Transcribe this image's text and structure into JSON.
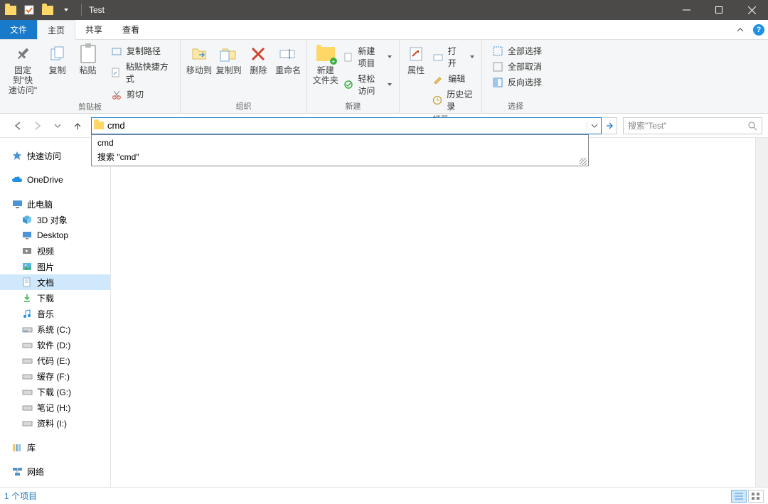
{
  "window": {
    "title": "Test"
  },
  "tabs": {
    "file": "文件",
    "home": "主页",
    "share": "共享",
    "view": "查看"
  },
  "ribbon": {
    "clipboard": {
      "pin_label_1": "固定到\"快",
      "pin_label_2": "速访问\"",
      "copy": "复制",
      "paste": "粘贴",
      "copy_path": "复制路径",
      "paste_shortcut": "粘贴快捷方式",
      "cut": "剪切",
      "group": "剪贴板"
    },
    "organize": {
      "move_to": "移动到",
      "copy_to": "复制到",
      "delete": "删除",
      "rename": "重命名",
      "group": "组织"
    },
    "new": {
      "new_folder": "新建",
      "new_folder2": "文件夹",
      "new_item": "新建项目",
      "easy_access": "轻松访问",
      "group": "新建"
    },
    "open": {
      "properties": "属性",
      "open": "打开",
      "edit": "编辑",
      "history": "历史记录",
      "group": "打开"
    },
    "select": {
      "select_all": "全部选择",
      "select_none": "全部取消",
      "invert": "反向选择",
      "group": "选择"
    }
  },
  "nav": {
    "address_value": "cmd",
    "autocomplete": {
      "item1": "cmd",
      "item2": "搜索 \"cmd\""
    },
    "search_placeholder": "搜索\"Test\""
  },
  "tree": {
    "quick_access": "快速访问",
    "onedrive": "OneDrive",
    "this_pc": "此电脑",
    "objects3d": "3D 对象",
    "desktop": "Desktop",
    "videos": "视频",
    "pictures": "图片",
    "documents": "文档",
    "downloads": "下载",
    "music": "音乐",
    "drive_c": "系统 (C:)",
    "drive_d": "软件 (D:)",
    "drive_e": "代码 (E:)",
    "drive_f": "缓存 (F:)",
    "drive_g": "下载 (G:)",
    "drive_h": "笔记 (H:)",
    "drive_i": "资料 (I:)",
    "libraries": "库",
    "network": "网络"
  },
  "status": {
    "item_count": "1 个项目"
  }
}
